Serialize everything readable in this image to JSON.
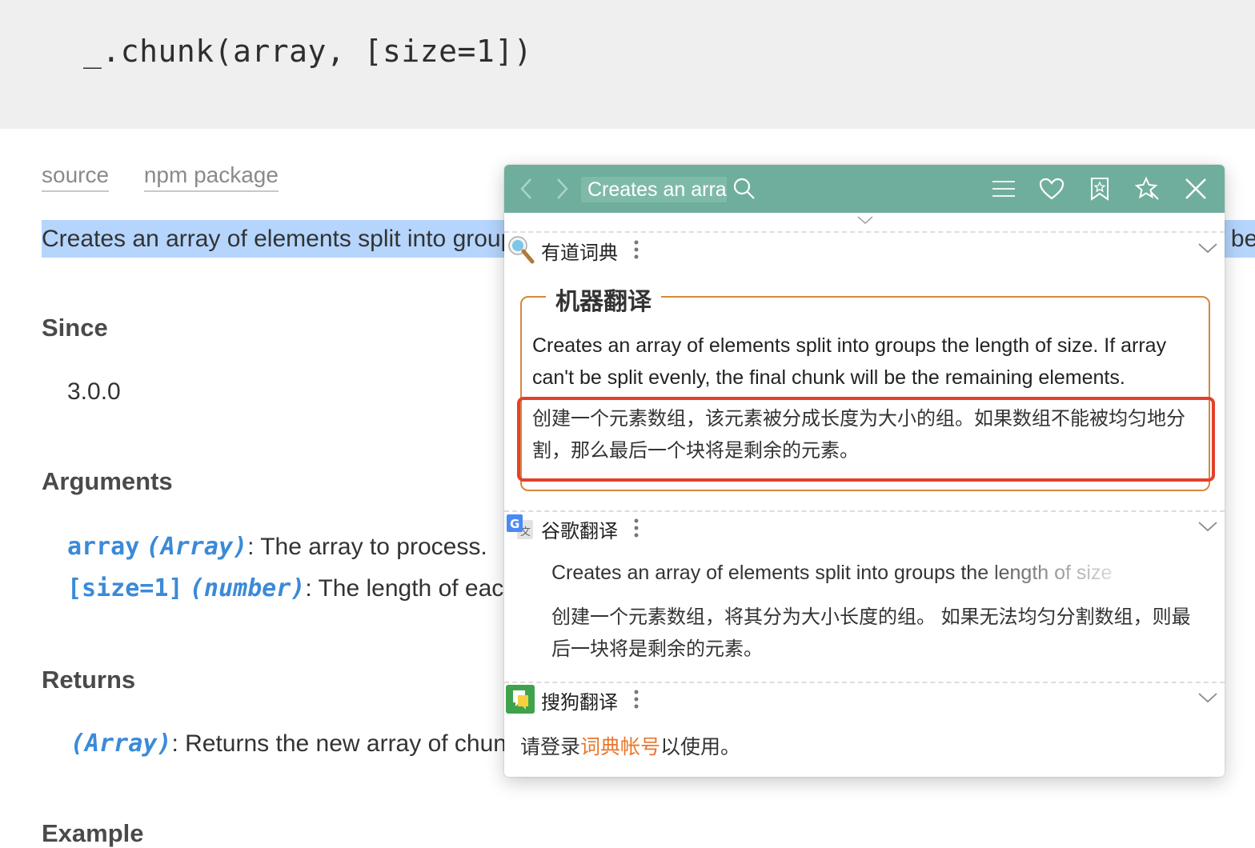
{
  "doc": {
    "signature": "_.chunk(array, [size=1])",
    "links": [
      "source",
      "npm package"
    ],
    "description": "Creates an array of elements split into groups the length of size. If array can't be split evenly, the final chunk will be the remaining elements.",
    "since_heading": "Since",
    "since_value": "3.0.0",
    "arguments_heading": "Arguments",
    "arguments": [
      {
        "name": "array",
        "type": "(Array)",
        "desc": ": The array to process."
      },
      {
        "name": "[size=1]",
        "type": "(number)",
        "desc": ": The length of each chunk"
      }
    ],
    "returns_heading": "Returns",
    "returns_type": "(Array)",
    "returns_desc": ": Returns the new array of chunks.",
    "example_heading": "Example"
  },
  "popup": {
    "query": "Creates an array of elements split into groups the length of size.",
    "youdao": {
      "title": "有道词典",
      "machine_translation_label": "机器翻译",
      "source_text": "Creates an array of elements split into groups the length of size. If array can't be split evenly, the final chunk will be the remaining elements.",
      "translation": "创建一个元素数组，该元素被分成长度为大小的组。如果数组不能被均匀地分割，那么最后一个块将是剩余的元素。"
    },
    "google": {
      "title": "谷歌翻译",
      "source_text": "Creates an array of elements split into groups the length of size",
      "translation": "创建一个元素数组，将其分为大小长度的组。 如果无法均匀分割数组，则最后一块将是剩余的元素。"
    },
    "sogou": {
      "title": "搜狗翻译",
      "login_prefix": "请登录",
      "login_link": "词典帐号",
      "login_suffix": "以使用。"
    },
    "icons": [
      "back-icon",
      "forward-icon",
      "search-icon",
      "menu-icon",
      "heart-icon",
      "bookmark-icon",
      "pin-icon",
      "close-icon"
    ],
    "colors": {
      "titlebar": "#6fae9c",
      "accent_border": "#d6883c",
      "highlight_box": "#e2412c",
      "link": "#e8762a"
    }
  }
}
